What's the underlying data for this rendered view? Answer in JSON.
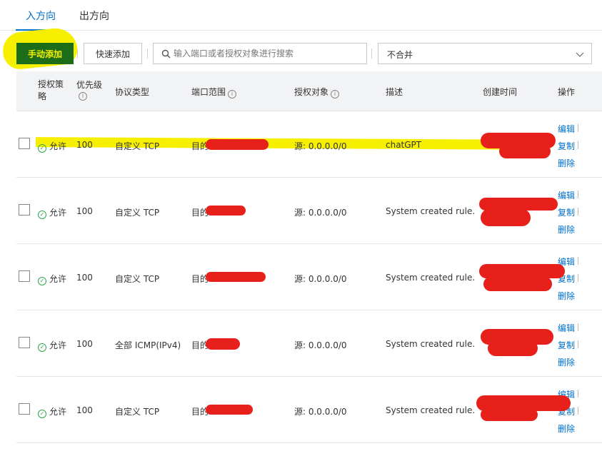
{
  "tabs": [
    {
      "label": "入方向",
      "active": true
    },
    {
      "label": "出方向",
      "active": false
    }
  ],
  "toolbar": {
    "manual_add_label": "手动添加",
    "quick_add_label": "快速添加",
    "search_placeholder": "输入端口或者授权对象进行搜索",
    "merge_select_value": "不合并"
  },
  "table": {
    "headers": {
      "policy": "授权策略",
      "priority": "优先级",
      "protocol": "协议类型",
      "port_range": "端口范围",
      "auth_object": "授权对象",
      "description": "描述",
      "created": "创建时间",
      "actions": "操作"
    },
    "rows": [
      {
        "policy": "允许",
        "priority": "100",
        "protocol": "自定义 TCP",
        "port_prefix": "目的",
        "auth": "源: 0.0.0.0/0",
        "description": "chatGPT"
      },
      {
        "policy": "允许",
        "priority": "100",
        "protocol": "自定义 TCP",
        "port_prefix": "目的",
        "auth": "源: 0.0.0.0/0",
        "description": "System created rule."
      },
      {
        "policy": "允许",
        "priority": "100",
        "protocol": "自定义 TCP",
        "port_prefix": "目的",
        "auth": "源: 0.0.0.0/0",
        "description": "System created rule."
      },
      {
        "policy": "允许",
        "priority": "100",
        "protocol": "全部 ICMP(IPv4)",
        "port_prefix": "目的",
        "auth": "源: 0.0.0.0/0",
        "description": "System created rule."
      },
      {
        "policy": "允许",
        "priority": "100",
        "protocol": "自定义 TCP",
        "port_prefix": "目的",
        "auth": "源: 0.0.0.0/0",
        "description": "System created rule."
      }
    ],
    "actions": {
      "edit": "编辑",
      "copy": "复制",
      "delete": "删除"
    }
  },
  "colors": {
    "accent": "#0070cc",
    "highlight": "#f6f000",
    "redaction": "#e8201c",
    "primary_button": "#1d6c1a",
    "success": "#2fa84f"
  },
  "icons": [
    "search-icon",
    "chevron-down-icon",
    "info-icon",
    "check-circle-icon"
  ]
}
